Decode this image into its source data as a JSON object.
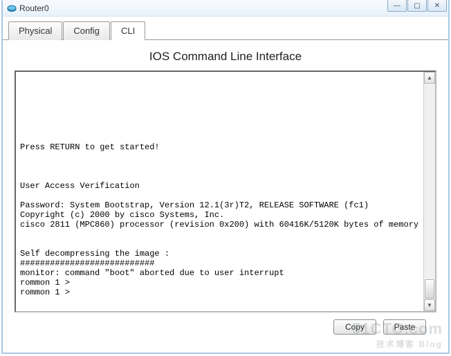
{
  "window": {
    "title": "Router0",
    "controls": {
      "min": "—",
      "max": "▢",
      "close": "✕"
    }
  },
  "tabs": [
    {
      "label": "Physical",
      "active": false
    },
    {
      "label": "Config",
      "active": false
    },
    {
      "label": "CLI",
      "active": true
    }
  ],
  "cli": {
    "heading": "IOS Command Line Interface",
    "output": "\n\n\n\n\n\n\nPress RETURN to get started!\n\n\n\nUser Access Verification\n\nPassword: System Bootstrap, Version 12.1(3r)T2, RELEASE SOFTWARE (fc1)\nCopyright (c) 2000 by cisco Systems, Inc.\ncisco 2811 (MPC860) processor (revision 0x200) with 60416K/5120K bytes of memory\n\n\nSelf decompressing the image :\n###########################\nmonitor: command \"boot\" aborted due to user interrupt\nrommon 1 >\nrommon 1 >"
  },
  "buttons": {
    "copy": "Copy",
    "paste": "Paste"
  },
  "watermark": {
    "main": "51CTO.com",
    "sub": "技术博客   Blog"
  }
}
